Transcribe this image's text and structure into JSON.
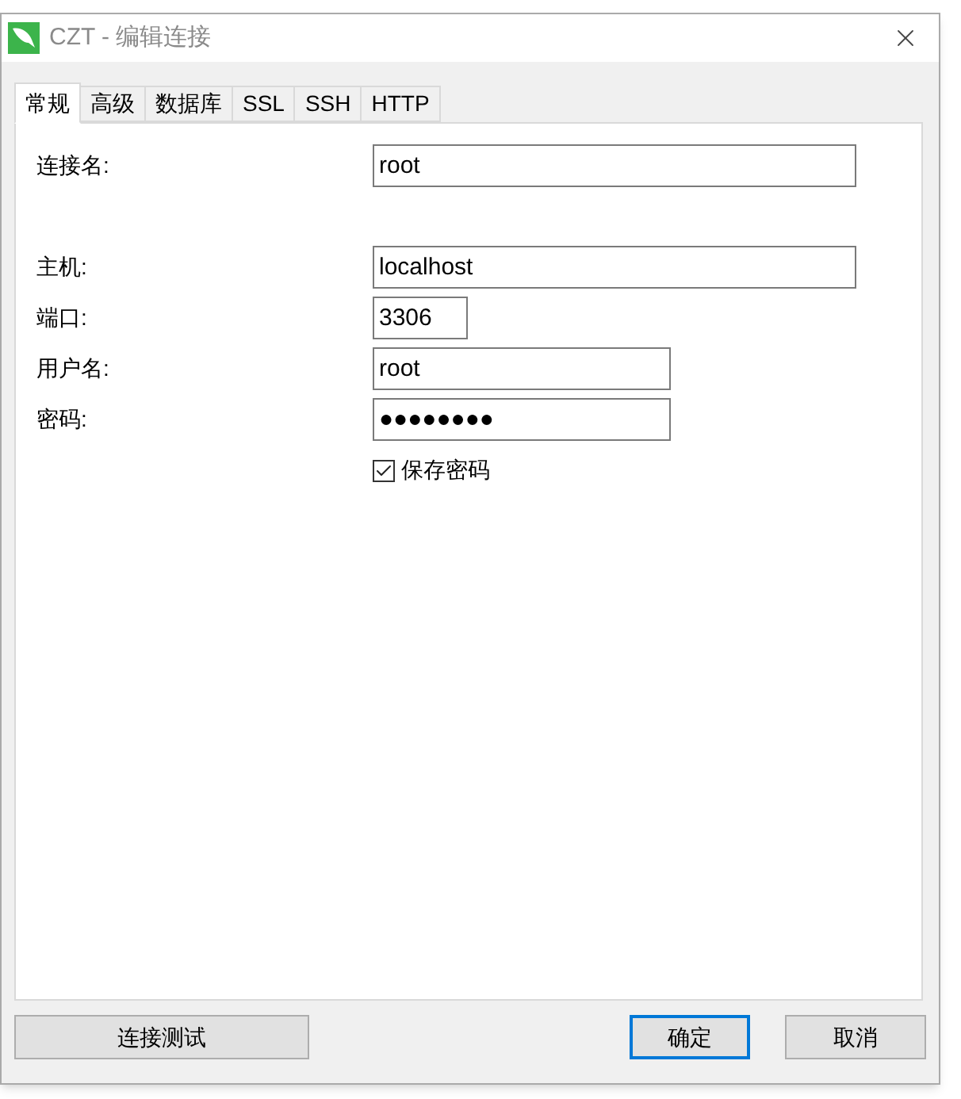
{
  "window": {
    "title": "CZT - 编辑连接"
  },
  "tabs": [
    {
      "label": "常规",
      "selected": true
    },
    {
      "label": "高级",
      "selected": false
    },
    {
      "label": "数据库",
      "selected": false
    },
    {
      "label": "SSL",
      "selected": false
    },
    {
      "label": "SSH",
      "selected": false
    },
    {
      "label": "HTTP",
      "selected": false
    }
  ],
  "fields": [
    {
      "label": "连接名:",
      "value": "root"
    },
    {
      "label": "主机:",
      "value": "localhost"
    },
    {
      "label": "端口:",
      "value": "3306"
    },
    {
      "label": "用户名:",
      "value": "root"
    },
    {
      "label": "密码:",
      "value": "●●●●●●●●"
    }
  ],
  "save_password": {
    "label": "保存密码",
    "checked": true
  },
  "buttons": [
    {
      "label": "连接测试",
      "focused": false,
      "kind": "left"
    },
    {
      "label": "确定",
      "focused": true,
      "kind": "right"
    },
    {
      "label": "取消",
      "focused": false,
      "kind": "right"
    }
  ]
}
